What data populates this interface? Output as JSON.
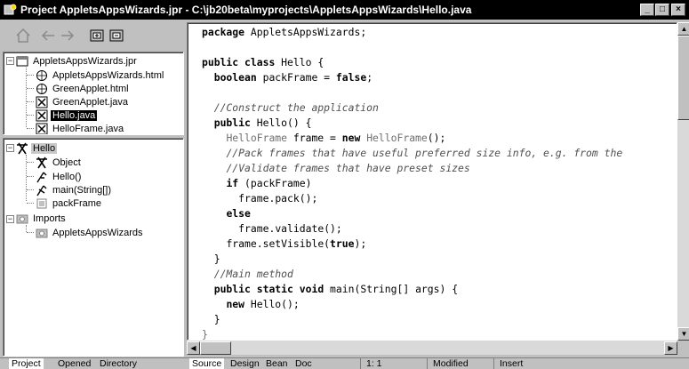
{
  "window": {
    "title": "Project AppletsAppsWizards.jpr - C:\\jb20beta\\myprojects\\AppletsAppsWizards\\Hello.java",
    "minimize_label": "_",
    "maximize_label": "□",
    "close_label": "×"
  },
  "toolbar": {
    "home_icon": "home-icon",
    "back_icon": "back-arrow-icon",
    "forward_icon": "forward-arrow-icon"
  },
  "project_tree": {
    "root": "AppletsAppsWizards.jpr",
    "items": [
      {
        "label": "AppletsAppsWizards.html",
        "icon": "html-file-icon"
      },
      {
        "label": "GreenApplet.html",
        "icon": "html-file-icon"
      },
      {
        "label": "GreenApplet.java",
        "icon": "java-applet-icon"
      },
      {
        "label": "Hello.java",
        "icon": "java-class-icon",
        "selected": true
      },
      {
        "label": "HelloFrame.java",
        "icon": "java-frame-icon"
      }
    ]
  },
  "structure_tree": {
    "root": "Hello",
    "members": [
      {
        "label": "Object",
        "icon": "class-icon"
      },
      {
        "label": "Hello()",
        "icon": "constructor-icon"
      },
      {
        "label": "main(String[])",
        "icon": "method-icon"
      },
      {
        "label": "packFrame",
        "icon": "field-icon"
      }
    ],
    "imports_label": "Imports",
    "imports": [
      {
        "label": "AppletsAppsWizards",
        "icon": "package-icon"
      }
    ]
  },
  "code_lines": [
    "package AppletsAppsWizards;",
    "",
    "public class Hello {",
    "  boolean packFrame = false;",
    "",
    "  //Construct the application",
    "  public Hello() {",
    "    HelloFrame frame = new HelloFrame();",
    "    //Pack frames that have useful preferred size info, e.g. from the",
    "    //Validate frames that have preset sizes",
    "    if (packFrame)",
    "      frame.pack();",
    "    else",
    "      frame.validate();",
    "    frame.setVisible(true);",
    "  }",
    "  //Main method",
    "  public static void main(String[] args) {",
    "    new Hello();",
    "  }",
    "}"
  ],
  "left_tabs": [
    "Project",
    "Opened",
    "Directory"
  ],
  "editor_tabs": [
    "Source",
    "Design",
    "Bean",
    "Doc"
  ],
  "status": {
    "position": "1: 1",
    "state": "Modified",
    "mode": "Insert"
  }
}
